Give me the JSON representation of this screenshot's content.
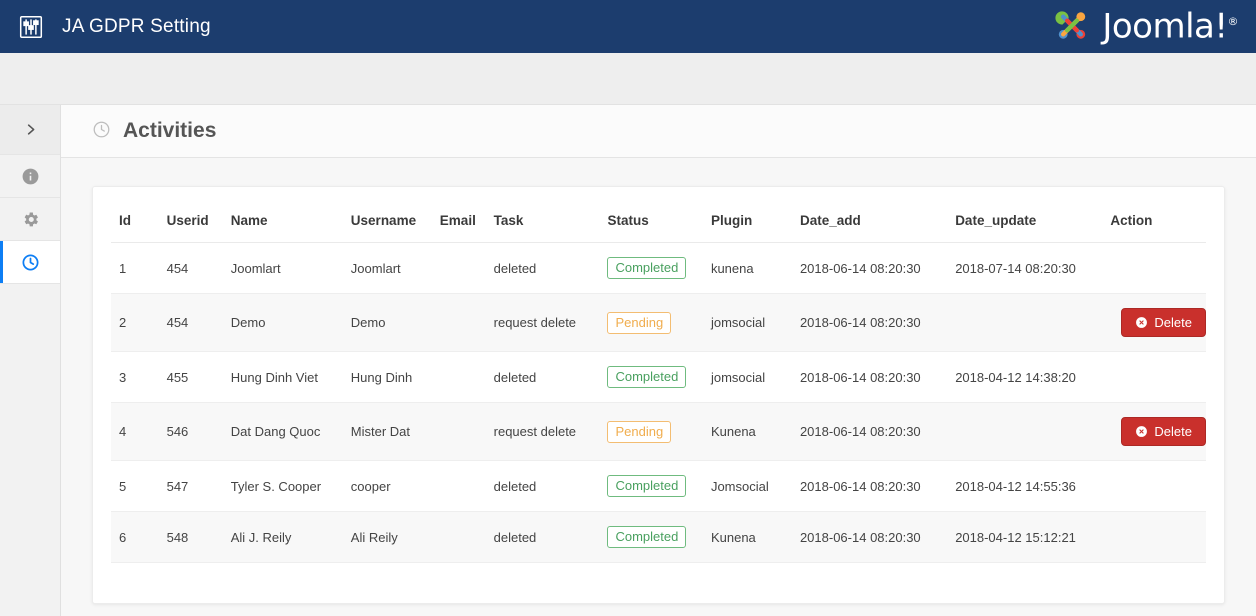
{
  "header": {
    "app_icon": "sliders-icon",
    "title": "JA GDPR Setting",
    "logo_text": "Joomla!",
    "logo_reg": "®",
    "bg_color": "#1c3d6e",
    "logo_colors": {
      "green": "#7ac143",
      "orange": "#f9a541",
      "blue": "#5091cd",
      "red": "#ee4035"
    }
  },
  "sidebar": {
    "items": [
      {
        "name": "expand-toggle",
        "icon": "chevron-right-icon",
        "active": false
      },
      {
        "name": "info",
        "icon": "info-circle-icon",
        "active": false
      },
      {
        "name": "settings",
        "icon": "gear-icon",
        "active": false
      },
      {
        "name": "activities",
        "icon": "clock-icon",
        "active": true
      }
    ],
    "active_color": "#0d7ef4"
  },
  "main": {
    "section_icon": "clock-icon",
    "section_title": "Activities",
    "table": {
      "columns": [
        "Id",
        "Userid",
        "Name",
        "Username",
        "Email",
        "Task",
        "Status",
        "Plugin",
        "Date_add",
        "Date_update",
        "Action"
      ],
      "rows": [
        {
          "id": "1",
          "userid": "454",
          "name": "Joomlart",
          "username": "Joomlart",
          "email": "",
          "task": "deleted",
          "status": "Completed",
          "status_type": "completed",
          "plugin": "kunena",
          "date_add": "2018-06-14 08:20:30",
          "date_update": "2018-07-14 08:20:30",
          "action": ""
        },
        {
          "id": "2",
          "userid": "454",
          "name": "Demo",
          "username": "Demo",
          "email": "",
          "task": "request delete",
          "status": "Pending",
          "status_type": "pending",
          "plugin": "jomsocial",
          "date_add": "2018-06-14 08:20:30",
          "date_update": "",
          "action": "Delete"
        },
        {
          "id": "3",
          "userid": "455",
          "name": "Hung Dinh Viet",
          "username": "Hung Dinh",
          "email": "",
          "task": "deleted",
          "status": "Completed",
          "status_type": "completed",
          "plugin": "jomsocial",
          "date_add": "2018-06-14 08:20:30",
          "date_update": "2018-04-12 14:38:20",
          "action": ""
        },
        {
          "id": "4",
          "userid": "546",
          "name": "Dat Dang Quoc",
          "username": "Mister Dat",
          "email": "",
          "task": "request delete",
          "status": "Pending",
          "status_type": "pending",
          "plugin": "Kunena",
          "date_add": "2018-06-14 08:20:30",
          "date_update": "",
          "action": "Delete"
        },
        {
          "id": "5",
          "userid": "547",
          "name": "Tyler S. Cooper",
          "username": "cooper",
          "email": "",
          "task": "deleted",
          "status": "Completed",
          "status_type": "completed",
          "plugin": "Jomsocial",
          "date_add": "2018-06-14 08:20:30",
          "date_update": "2018-04-12 14:55:36",
          "action": ""
        },
        {
          "id": "6",
          "userid": "548",
          "name": "Ali J. Reily",
          "username": "Ali Reily",
          "email": "",
          "task": "deleted",
          "status": "Completed",
          "status_type": "completed",
          "plugin": "Kunena",
          "date_add": "2018-06-14 08:20:30",
          "date_update": "2018-04-12 15:12:21",
          "action": ""
        }
      ]
    }
  },
  "colors": {
    "completed": "#49a05f",
    "pending": "#f0ad4e",
    "delete_button": "#c9302c"
  }
}
